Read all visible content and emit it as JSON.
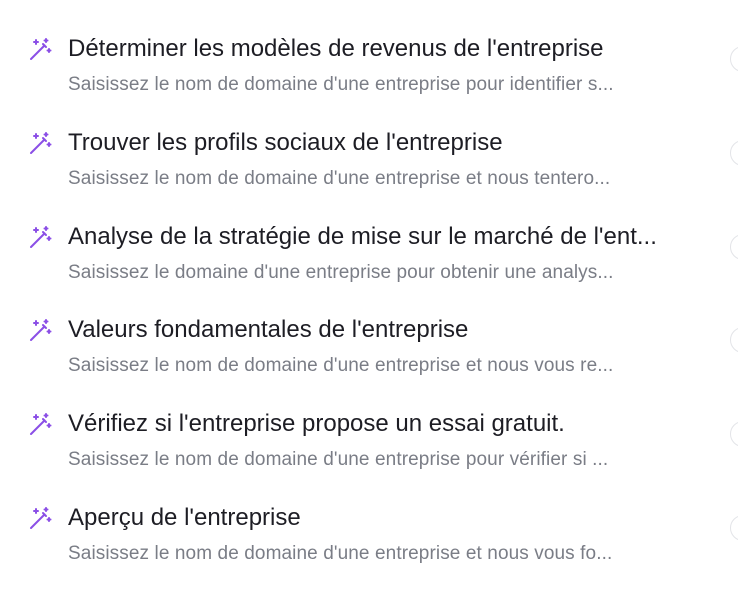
{
  "colors": {
    "icon": "#8b4fe6",
    "title": "#1d1d24",
    "description": "#7a7d86",
    "border": "#e3e4e8"
  },
  "items": [
    {
      "icon": "magic-wand-icon",
      "title": "Déterminer les modèles de revenus de l'entreprise",
      "description": "Saisissez le nom de domaine d'une entreprise pour identifier s..."
    },
    {
      "icon": "magic-wand-icon",
      "title": "Trouver les profils sociaux de l'entreprise",
      "description": "Saisissez le nom de domaine d'une entreprise et nous tentero..."
    },
    {
      "icon": "magic-wand-icon",
      "title": "Analyse de la stratégie de mise sur le marché de l'ent...",
      "description": "Saisissez le domaine d'une entreprise pour obtenir une analys..."
    },
    {
      "icon": "magic-wand-icon",
      "title": "Valeurs fondamentales de l'entreprise",
      "description": "Saisissez le nom de domaine d'une entreprise et nous vous re..."
    },
    {
      "icon": "magic-wand-icon",
      "title": "Vérifiez si l'entreprise propose un essai gratuit.",
      "description": "Saisissez le nom de domaine d'une entreprise pour vérifier si ..."
    },
    {
      "icon": "magic-wand-icon",
      "title": "Aperçu de l'entreprise",
      "description": "Saisissez le nom de domaine d'une entreprise et nous vous fo..."
    }
  ]
}
